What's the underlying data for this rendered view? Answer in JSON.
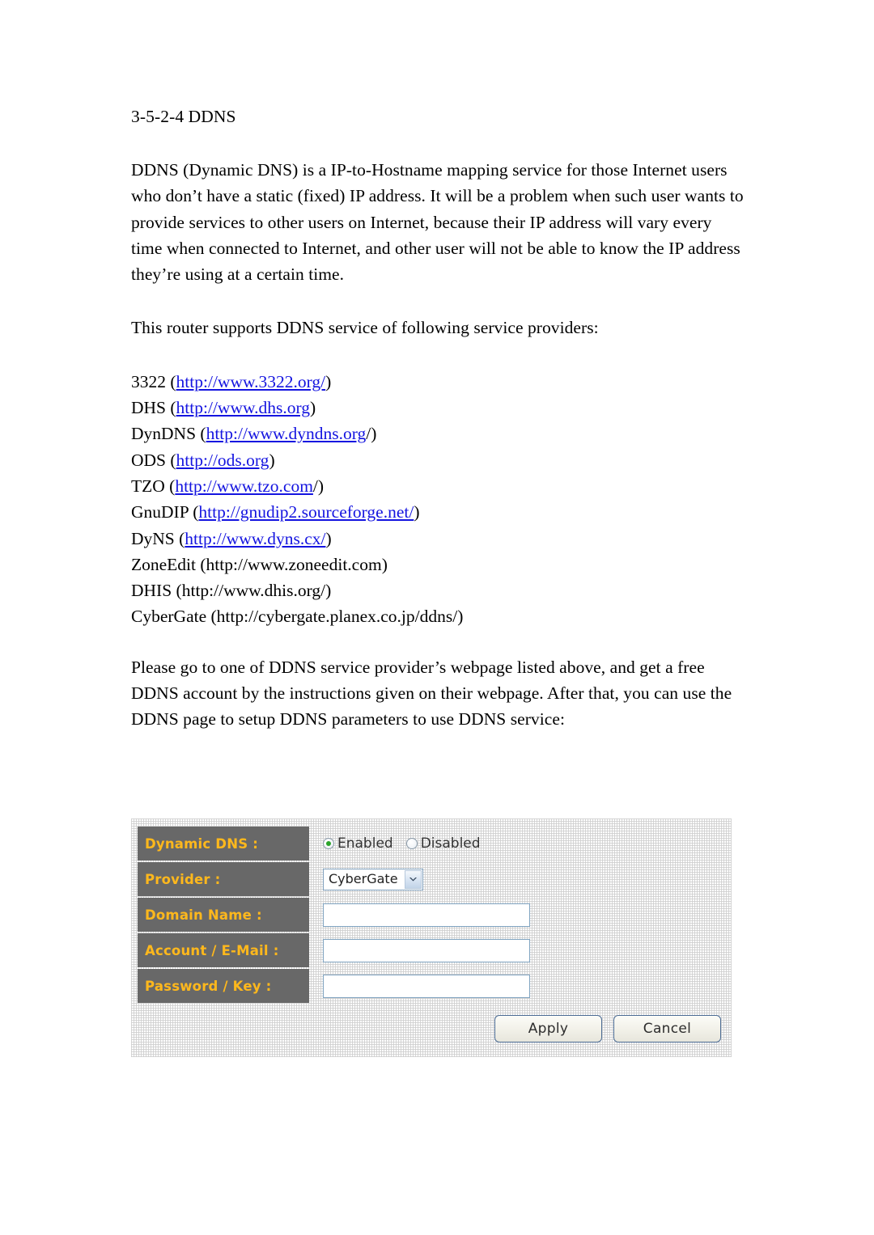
{
  "document": {
    "heading": "3-5-2-4 DDNS",
    "intro_paragraph": "DDNS (Dynamic DNS) is a IP-to-Hostname mapping service for those Internet users who don’t have a static (fixed) IP address. It will be a problem when such user wants to provide services to other users on Internet, because their IP address will vary every time when connected to Internet, and other user will not be able to know the IP address they’re using at a certain time.",
    "providers_intro": "This router supports DDNS service of following service providers:",
    "closing_paragraph": "Please go to one of DDNS service provider’s webpage listed above, and get a free DDNS account by the instructions given on their webpage. After that, you can use the DDNS page to setup DDNS parameters to use DDNS service:"
  },
  "providers": [
    {
      "name": "3322",
      "open": " (",
      "url": "http://www.3322.org/",
      "url_linked": true,
      "close": ")"
    },
    {
      "name": "DHS",
      "open": " (",
      "url": "http://www.dhs.org",
      "url_linked": true,
      "close": ")"
    },
    {
      "name": "DynDNS",
      "open": " (",
      "url": "http://www.dyndns.org",
      "url_linked": true,
      "close": "/)"
    },
    {
      "name": "ODS",
      "open": " (",
      "url": "http://ods.org",
      "url_linked": true,
      "close": ")"
    },
    {
      "name": "TZO",
      "open": " (",
      "url": "http://www.tzo.com",
      "url_linked": true,
      "close": "/)"
    },
    {
      "name": "GnuDIP",
      "open": " (",
      "url": "http://gnudip2.sourceforge.net/",
      "url_linked": true,
      "close": ")"
    },
    {
      "name": "DyNS",
      "open": " (",
      "url": "http://www.dyns.cx/",
      "url_linked": true,
      "close": ")"
    },
    {
      "name": "ZoneEdit",
      "open": " (",
      "url": "http://www.zoneedit.com",
      "url_linked": false,
      "close": ")"
    },
    {
      "name": "DHIS",
      "open": " (",
      "url": "http://www.dhis.org/",
      "url_linked": false,
      "close": ")"
    },
    {
      "name": "CyberGate",
      "open": " (",
      "url": "http://cybergate.planex.co.jp/ddns/",
      "url_linked": false,
      "close": ")"
    }
  ],
  "router_panel": {
    "rows": {
      "dynamic_dns": {
        "label": "Dynamic DNS :",
        "enabled_label": "Enabled",
        "disabled_label": "Disabled",
        "selected": "Enabled"
      },
      "provider": {
        "label": "Provider :",
        "selected_value": "CyberGate",
        "arrow_icon": "chevron-down-icon"
      },
      "domain_name": {
        "label": "Domain Name :",
        "value": "",
        "placeholder": ""
      },
      "account_email": {
        "label": "Account / E-Mail :",
        "value": "",
        "placeholder": ""
      },
      "password_key": {
        "label": "Password / Key :",
        "value": "",
        "placeholder": ""
      }
    },
    "buttons": {
      "apply": "Apply",
      "cancel": "Cancel"
    },
    "colors": {
      "label_background": "#686868",
      "label_text": "#ffb81c",
      "input_border": "#7fa3c0",
      "button_border": "#4a6a93",
      "radio_selected": "#2aa32a"
    }
  }
}
